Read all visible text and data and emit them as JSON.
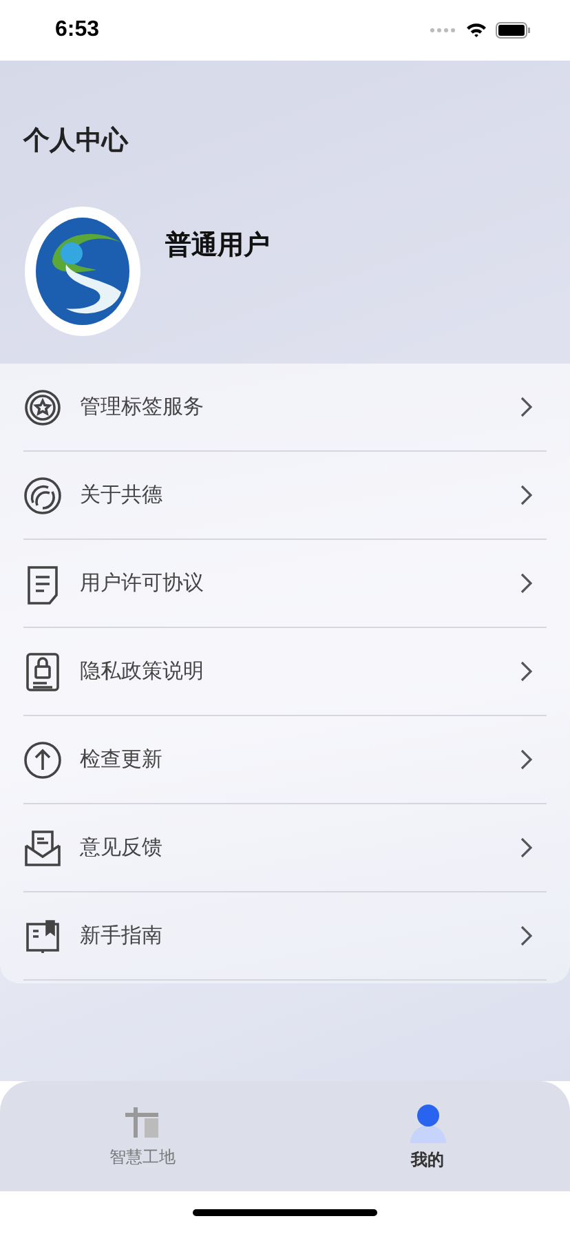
{
  "status_bar": {
    "time": "6:53"
  },
  "page_title": "个人中心",
  "profile": {
    "name": "普通用户"
  },
  "menu": [
    {
      "kind": "star",
      "label": "管理标签服务"
    },
    {
      "kind": "swirl",
      "label": "关于共德"
    },
    {
      "kind": "document",
      "label": "用户许可协议"
    },
    {
      "kind": "lock",
      "label": "隐私政策说明"
    },
    {
      "kind": "upload",
      "label": "检查更新"
    },
    {
      "kind": "mail",
      "label": "意见反馈"
    },
    {
      "kind": "book",
      "label": "新手指南"
    }
  ],
  "tabs": [
    {
      "kind": "site",
      "label": "智慧工地",
      "selected": false
    },
    {
      "kind": "person",
      "label": "我的",
      "selected": true
    }
  ]
}
